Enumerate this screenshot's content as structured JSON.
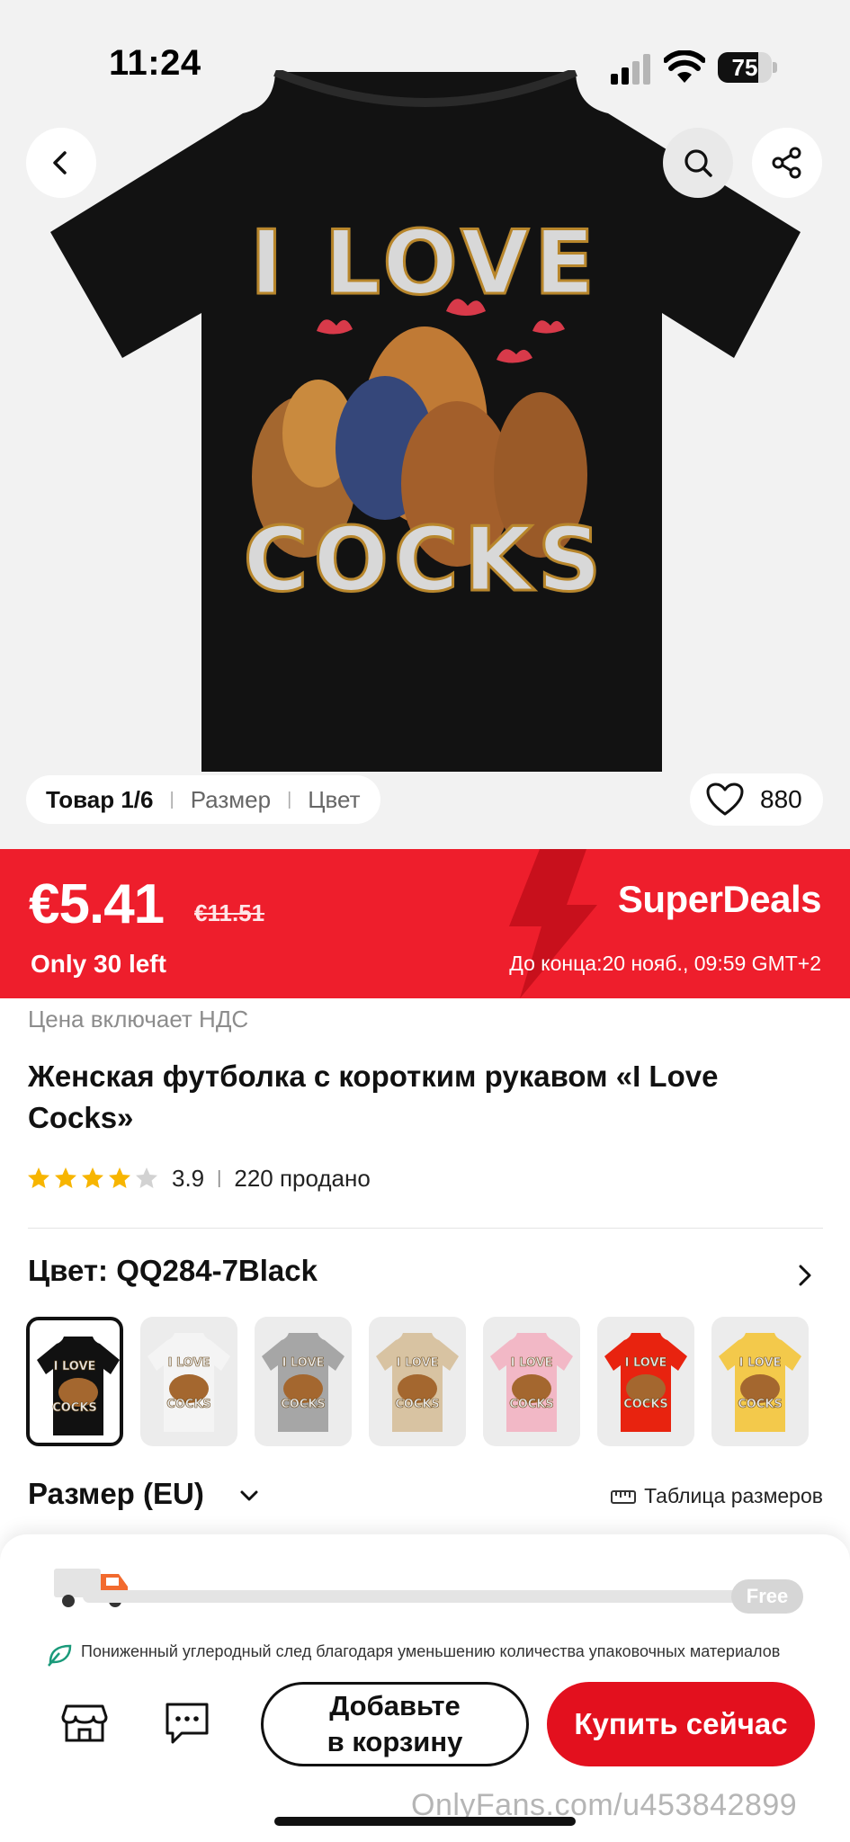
{
  "status_bar": {
    "time": "11:24",
    "battery": "75",
    "battery_level": 0.75,
    "signal_bars_active": 2,
    "signal_bars_total": 4
  },
  "hero": {
    "back_icon": "chevron-left-icon",
    "search_icon": "search-icon",
    "share_icon": "share-icon",
    "print_line1": "I LOVE",
    "print_line2": "COCKS",
    "info_pill": {
      "item": "Товар 1/6",
      "size": "Размер",
      "color": "Цвет"
    },
    "likes": "880"
  },
  "deal": {
    "price": "€5.41",
    "old_price": "€11.51",
    "stock": "Only 30 left",
    "brand": "SuperDeals",
    "countdown": "До конца:20 нояб., 09:59 GMT+2",
    "bg_color": "#ee1e2c"
  },
  "product": {
    "vat_note": "Цена включает НДС",
    "title": "Женская футболка с коротким рукавом «I Love Cocks»",
    "rating": "3.9",
    "rating_stars": 3.9,
    "sold": "220 продано"
  },
  "color": {
    "label": "Цвет: QQ284-7Black",
    "swatches": [
      {
        "name": "black",
        "hex": "#111111",
        "selected": true
      },
      {
        "name": "white",
        "hex": "#f4f4f4",
        "selected": false
      },
      {
        "name": "grey",
        "hex": "#a6a6a6",
        "selected": false
      },
      {
        "name": "beige",
        "hex": "#d8c3a2",
        "selected": false
      },
      {
        "name": "pink",
        "hex": "#f2b8c6",
        "selected": false
      },
      {
        "name": "red",
        "hex": "#e8230f",
        "selected": false
      },
      {
        "name": "yellow",
        "hex": "#f3c94b",
        "selected": false
      }
    ],
    "swatch_text_1": "I LOVE",
    "swatch_text_2": "COCKS"
  },
  "size": {
    "label": "Размер (EU)",
    "size_chart": "Таблица размеров"
  },
  "shipping": {
    "free": "Free",
    "progress": 0,
    "eco_note": "Пониженный углеродный след благодаря уменьшению количества упаковочных материалов"
  },
  "actions": {
    "store_icon": "store-icon",
    "chat_icon": "chat-icon",
    "add_to_cart_line1": "Добавьте",
    "add_to_cart_line2": "в корзину",
    "buy_now": "Купить сейчас"
  },
  "watermark": "OnlyFans.com/u453842899"
}
